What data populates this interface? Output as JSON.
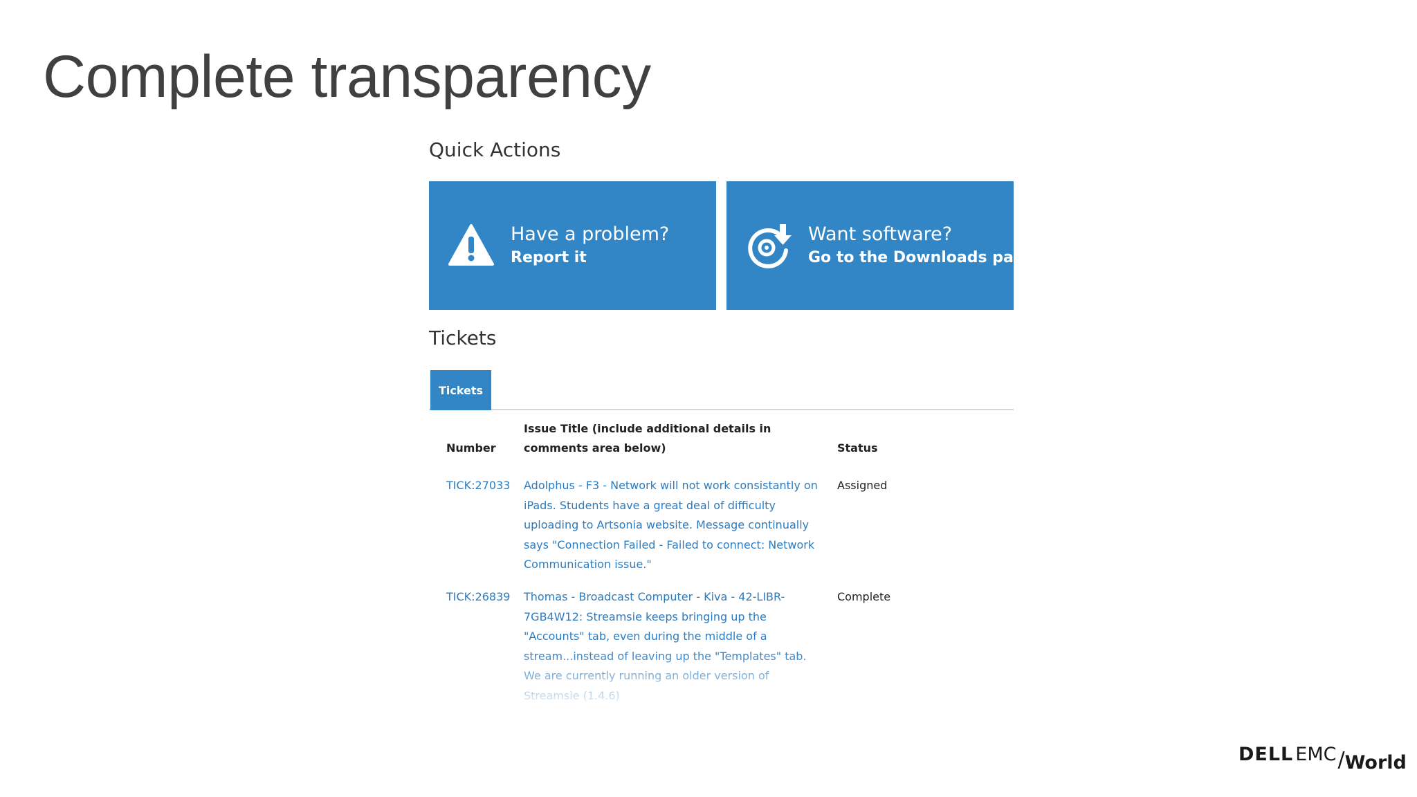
{
  "slide": {
    "title": "Complete transparency"
  },
  "quick_actions": {
    "heading": "Quick Actions",
    "tiles": [
      {
        "title": "Have a problem?",
        "subtitle": "Report it",
        "icon": "warning-icon"
      },
      {
        "title": "Want software?",
        "subtitle": "Go to the Downloads page",
        "icon": "download-icon"
      }
    ]
  },
  "tickets": {
    "heading": "Tickets",
    "tab_label": "Tickets",
    "columns": {
      "number": "Number",
      "title": "Issue Title (include additional details in comments area below)",
      "status": "Status"
    },
    "rows": [
      {
        "number": "TICK:27033",
        "title": "Adolphus - F3 - Network will not work consistantly on iPads. Students have a great deal of difficulty uploading to Artsonia website. Message continually says \"Connection Failed - Failed to connect: Network Communication issue.\"",
        "status": "Assigned"
      },
      {
        "number": "TICK:26839",
        "title": "Thomas - Broadcast Computer - Kiva - 42-LIBR-7GB4W12: Streamsie keeps bringing up the \"Accounts\" tab, even during the middle of a stream...instead of leaving up the \"Templates\" tab. We are currently running an older version of Streamsie (1.4.6)",
        "status": "Complete"
      }
    ]
  },
  "brand": {
    "dell": "DELL",
    "emc": "EMC",
    "slash": "/",
    "world": "World"
  },
  "colors": {
    "tile_blue": "#3386c6",
    "link_blue": "#2c7bbf",
    "title_gray": "#404040"
  }
}
